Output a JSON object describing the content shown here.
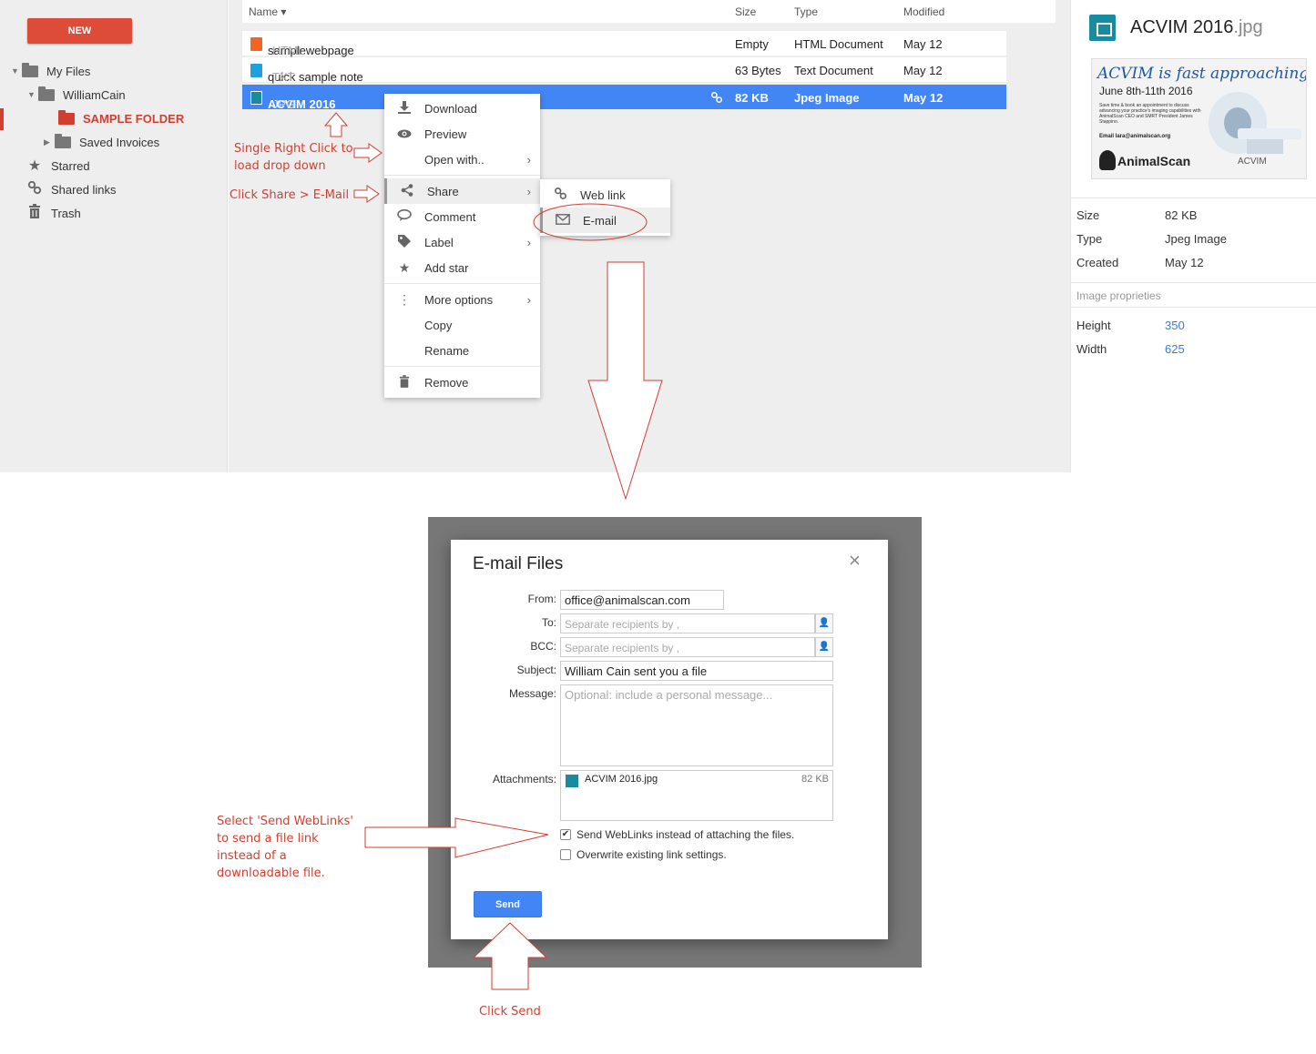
{
  "sidebar": {
    "new_label": "NEW",
    "tree": [
      {
        "label": "My Files"
      },
      {
        "label": "WilliamCain"
      },
      {
        "label": "SAMPLE FOLDER"
      },
      {
        "label": "Saved Invoices"
      }
    ],
    "nav": [
      {
        "label": "Starred",
        "icon": "star-icon"
      },
      {
        "label": "Shared links",
        "icon": "link-icon"
      },
      {
        "label": "Trash",
        "icon": "trash-icon"
      }
    ]
  },
  "list": {
    "columns": {
      "name": "Name ▾",
      "size": "Size",
      "type": "Type",
      "modified": "Modified"
    },
    "rows": [
      {
        "name": "samplewebpage",
        "ext": "HTML",
        "size": "Empty",
        "type": "HTML Document",
        "modified": "May 12",
        "icon": "html-file-icon"
      },
      {
        "name": "quick sample note",
        "ext": "TXT",
        "size": "63 Bytes",
        "type": "Text Document",
        "modified": "May 12",
        "icon": "text-file-icon"
      },
      {
        "name": "ACVIM 2016",
        "ext": "JPG",
        "size": "82 KB",
        "type": "Jpeg Image",
        "modified": "May 12",
        "icon": "image-file-icon",
        "selected": true
      }
    ]
  },
  "context_menu": {
    "items": [
      {
        "label": "Download",
        "icon": "download-icon"
      },
      {
        "label": "Preview",
        "icon": "eye-icon"
      },
      {
        "label": "Open with..",
        "icon": "",
        "submenu": true
      },
      {
        "label": "Share",
        "icon": "share-icon",
        "submenu": true
      },
      {
        "label": "Comment",
        "icon": "comment-icon"
      },
      {
        "label": "Label",
        "icon": "tag-icon",
        "submenu": true
      },
      {
        "label": "Add star",
        "icon": "star-icon"
      },
      {
        "label": "More options",
        "icon": "more-vert-icon",
        "submenu": true
      },
      {
        "label": "Copy",
        "icon": ""
      },
      {
        "label": "Rename",
        "icon": ""
      },
      {
        "label": "Remove",
        "icon": "trash-icon"
      }
    ],
    "share_submenu": [
      {
        "label": "Web link",
        "icon": "link-icon"
      },
      {
        "label": "E-mail",
        "icon": "envelope-icon"
      }
    ]
  },
  "annotations": {
    "right_click": [
      "Single Right Click to",
      "load drop down"
    ],
    "share_email": "Click Share > E-Mail",
    "weblinks": [
      "Select 'Send WebLinks'",
      "to send a file link",
      "instead of a",
      "downloadable file."
    ],
    "send": "Click Send",
    "color": "#d23f31"
  },
  "details": {
    "title": "ACVIM 2016",
    "ext": ".jpg",
    "preview": {
      "headline": "ACVIM is fast approaching!",
      "dates": "June 8th-11th 2016",
      "body": "Save time & book an appointment to discuss advancing your practice's imaging capabilities with AnimalScan CEO and SMRT President James Stappino.",
      "email": "Email lara@animalscan.org",
      "brand": "AnimalScan",
      "brand2": "ACVIM"
    },
    "props": [
      {
        "key": "Size",
        "value": "82 KB"
      },
      {
        "key": "Type",
        "value": "Jpeg Image"
      },
      {
        "key": "Created",
        "value": "May 12"
      }
    ],
    "image_section": "Image proprieties",
    "image_props": [
      {
        "key": "Height",
        "value": "350"
      },
      {
        "key": "Width",
        "value": "625"
      }
    ]
  },
  "dialog": {
    "title": "E-mail Files",
    "close": "×",
    "from_label": "From:",
    "from_value": "office@animalscan.com",
    "to_label": "To:",
    "to_placeholder": "Separate recipients by ,",
    "bcc_label": "BCC:",
    "bcc_placeholder": "Separate recipients by ,",
    "subject_label": "Subject:",
    "subject_value": "William Cain sent you a file",
    "message_label": "Message:",
    "message_placeholder": "Optional: include a personal message...",
    "attachments_label": "Attachments:",
    "attachment": {
      "name": "ACVIM 2016.jpg",
      "size": "82 KB"
    },
    "opt_weblinks": "Send WebLinks instead of attaching the files.",
    "opt_weblinks_checked": true,
    "opt_overwrite": "Overwrite existing link settings.",
    "opt_overwrite_checked": false,
    "send_label": "Send"
  }
}
